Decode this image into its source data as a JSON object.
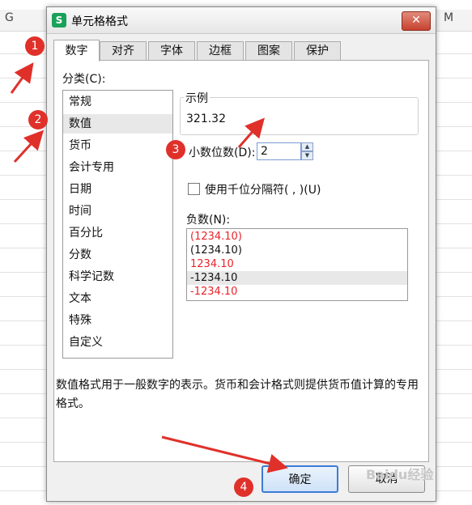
{
  "spreadsheet": {
    "col_left": "G",
    "col_right": "M"
  },
  "dialog": {
    "title": "单元格格式",
    "close_glyph": "✕",
    "tabs": [
      "数字",
      "对齐",
      "字体",
      "边框",
      "图案",
      "保护"
    ],
    "category_label": "分类(C):",
    "categories": [
      "常规",
      "数值",
      "货币",
      "会计专用",
      "日期",
      "时间",
      "百分比",
      "分数",
      "科学记数",
      "文本",
      "特殊",
      "自定义"
    ],
    "sample_label": "示例",
    "sample_value": "321.32",
    "decimal_label": "小数位数(D):",
    "decimal_value": "2",
    "thousands_label": "使用千位分隔符( , )(U)",
    "negative_label": "负数(N):",
    "negative_options": [
      "(1234.10)",
      "(1234.10)",
      "1234.10",
      "-1234.10",
      "-1234.10"
    ],
    "description": "数值格式用于一般数字的表示。货币和会计格式则提供货币值计算的专用格式。",
    "ok_label": "确定",
    "cancel_label": "取消"
  },
  "markers": [
    "1",
    "2",
    "3",
    "4"
  ],
  "colors": {
    "negative_red": "#e8232a",
    "marker_red": "#e0302a",
    "accent_blue": "#3d7bd6"
  },
  "watermark": "Baidu经验"
}
